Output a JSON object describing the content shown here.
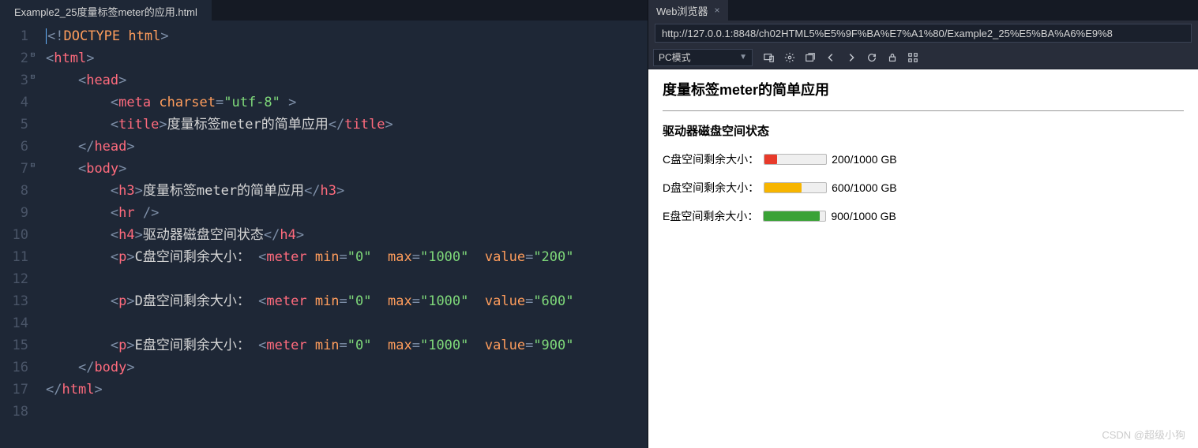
{
  "editor": {
    "tab_title": "Example2_25度量标签meter的应用.html",
    "code": {
      "l1_doctype": "DOCTYPE",
      "l1_html": "html",
      "l2_html": "html",
      "l3_head": "head",
      "l4_meta": "meta",
      "l4_attr_charset": "charset",
      "l4_val_charset": "\"utf-8\"",
      "l5_title": "title",
      "l5_text": "度量标签meter的简单应用",
      "l6_head": "head",
      "l7_body": "body",
      "l8_h3": "h3",
      "l8_text": "度量标签meter的简单应用",
      "l9_hr": "hr",
      "l10_h4": "h4",
      "l10_text": "驱动器磁盘空间状态",
      "l11_p": "p",
      "l11_text": "C盘空间剩余大小：",
      "l11_meter": "meter",
      "l11_min": "min",
      "l11_min_v": "\"0\"",
      "l11_max": "max",
      "l11_max_v": "\"1000\"",
      "l11_val": "value",
      "l11_val_v": "\"200\"",
      "l13_p": "p",
      "l13_text": "D盘空间剩余大小：",
      "l13_meter": "meter",
      "l13_min": "min",
      "l13_min_v": "\"0\"",
      "l13_max": "max",
      "l13_max_v": "\"1000\"",
      "l13_val": "value",
      "l13_val_v": "\"600\"",
      "l15_p": "p",
      "l15_text": "E盘空间剩余大小：",
      "l15_meter": "meter",
      "l15_min": "min",
      "l15_min_v": "\"0\"",
      "l15_max": "max",
      "l15_max_v": "\"1000\"",
      "l15_val": "value",
      "l15_val_v": "\"900\"",
      "l16_body": "body",
      "l17_html": "html"
    },
    "line_numbers": [
      "1",
      "2",
      "3",
      "4",
      "5",
      "6",
      "7",
      "8",
      "9",
      "10",
      "11",
      "12",
      "13",
      "14",
      "15",
      "16",
      "17",
      "18"
    ]
  },
  "browser": {
    "tab_title": "Web浏览器",
    "url": "http://127.0.0.1:8848/ch02HTML5%E5%9F%BA%E7%A1%80/Example2_25%E5%BA%A6%E9%8",
    "mode": "PC模式"
  },
  "preview": {
    "h3": "度量标签meter的简单应用",
    "h4": "驱动器磁盘空间状态",
    "rows": [
      {
        "label": "C盘空间剩余大小：",
        "value_text": "200/1000 GB"
      },
      {
        "label": "D盘空间剩余大小：",
        "value_text": "600/1000 GB"
      },
      {
        "label": "E盘空间剩余大小：",
        "value_text": "900/1000 GB"
      }
    ]
  },
  "watermark": "CSDN @超级小狗"
}
